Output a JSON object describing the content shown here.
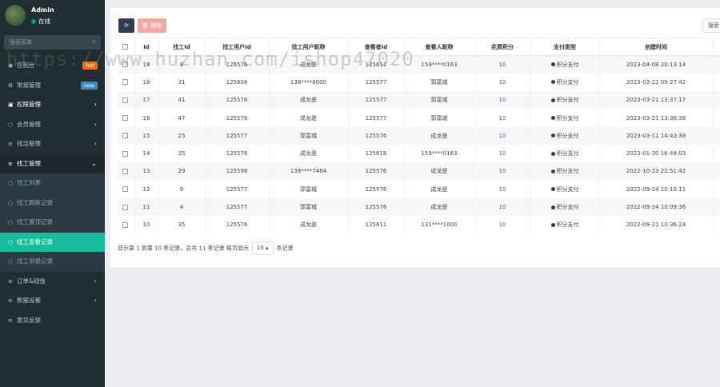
{
  "user": {
    "name": "Admin",
    "status": "在线"
  },
  "sidebar": {
    "search_placeholder": "搜索菜单",
    "items": [
      {
        "label": "控制台",
        "icon": "dashboard-icon",
        "badge": "hot",
        "badge_color": "#ff6b00"
      },
      {
        "label": "常规管理",
        "icon": "cogs-icon",
        "badge": "new",
        "badge_color": "#3c8dbc"
      },
      {
        "label": "权限管理",
        "icon": "group-icon",
        "arrow": "‹"
      },
      {
        "label": "会员管理",
        "icon": "user-icon",
        "arrow": "‹"
      },
      {
        "label": "找活管理",
        "icon": "list-icon",
        "arrow": "‹"
      },
      {
        "label": "找工管理",
        "icon": "list-icon",
        "arrow": "⌄"
      }
    ],
    "sub_items": [
      {
        "label": "找工列表"
      },
      {
        "label": "找工刷新记录"
      },
      {
        "label": "找工置顶记录"
      },
      {
        "label": "找工查看记录"
      },
      {
        "label": "找工举报记录"
      }
    ],
    "bottom_items": [
      {
        "label": "订单&短信",
        "arrow": "‹"
      },
      {
        "label": "数据设置",
        "arrow": "‹"
      },
      {
        "label": "意见反馈"
      }
    ]
  },
  "toolbar": {
    "refresh_icon": "⟳",
    "delete_label": "🗑 删除"
  },
  "search_label": "搜索",
  "watermark": "https://www.huzhan.com/ishop47020",
  "table": {
    "columns": [
      "Id",
      "找工Id",
      "找工用户Id",
      "找工用户昵称",
      "查看者Id",
      "查看人昵称",
      "花费积分",
      "支付类型",
      "创建时间"
    ],
    "rows": [
      [
        "19",
        "8",
        "125576",
        "成龙是",
        "125611",
        "159****0163",
        "10",
        "积分支付",
        "2023-04-08 20:13:14"
      ],
      [
        "18",
        "31",
        "125608",
        "138****8000",
        "125577",
        "郭富城",
        "10",
        "积分支付",
        "2023-03-22 09:27:42"
      ],
      [
        "17",
        "41",
        "125576",
        "成龙是",
        "125577",
        "郭富城",
        "10",
        "积分支付",
        "2023-03-21 13:37:17"
      ],
      [
        "16",
        "47",
        "125576",
        "成龙是",
        "125577",
        "郭富城",
        "10",
        "积分支付",
        "2023-03-21 13:36:38"
      ],
      [
        "15",
        "25",
        "125577",
        "郭富城",
        "125576",
        "成龙是",
        "10",
        "积分支付",
        "2023-03-11 14:43:38"
      ],
      [
        "14",
        "35",
        "125576",
        "成龙是",
        "125618",
        "159****0163",
        "10",
        "积分支付",
        "2023-01-30 16:49:03"
      ],
      [
        "13",
        "29",
        "125598",
        "138****7484",
        "125576",
        "成龙是",
        "10",
        "积分支付",
        "2022-10-23 22:51:42"
      ],
      [
        "12",
        "9",
        "125577",
        "郭富城",
        "125576",
        "成龙是",
        "10",
        "积分支付",
        "2022-09-24 10:10:11"
      ],
      [
        "11",
        "4",
        "125577",
        "郭富城",
        "125576",
        "成龙是",
        "10",
        "积分支付",
        "2022-09-24 10:09:36"
      ],
      [
        "10",
        "35",
        "125576",
        "成龙是",
        "125611",
        "131****1000",
        "10",
        "积分支付",
        "2022-09-21 10:36:24"
      ]
    ]
  },
  "pager": {
    "summary": "显示第 1 到第 10 条记录，总共 11 条记录 每页显示",
    "page_size": "10 ▴",
    "suffix": "条记录"
  }
}
